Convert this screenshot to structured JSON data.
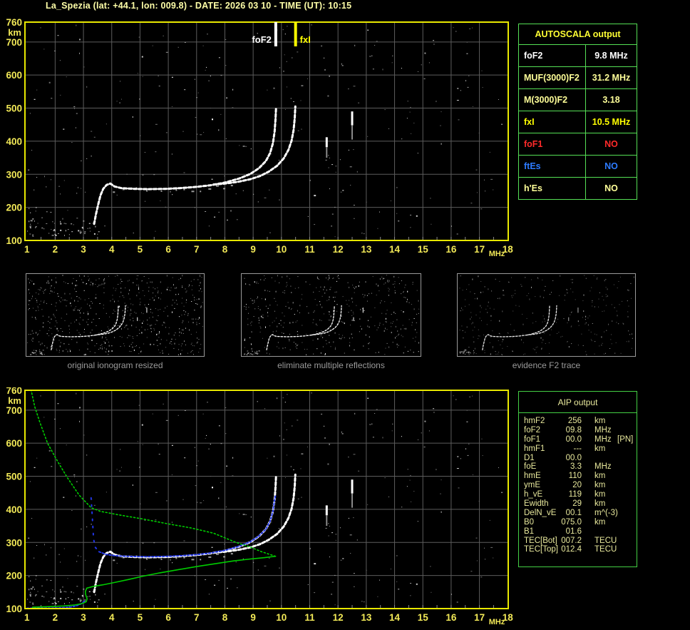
{
  "title": "La_Spezia (lat: +44.1, lon: 009.8) - DATE: 2026 03 10 - TIME (UT): 10:15",
  "colors": {
    "background": "#000000",
    "plot_border": "#e8e800",
    "grid": "#5c5c5c",
    "axis_label": "#f2e957",
    "title_text": "#ffffa8",
    "autoscala_border": "#55e055",
    "aip_border": "#44d044",
    "aip_text": "#e8e89c",
    "echo_trace_white": "#ffffff",
    "restored_trace_blue": "#2236e8",
    "profile_green": "#00cc00",
    "caption_gray": "#9a9a9a"
  },
  "autoscala": {
    "header": "AUTOSCALA output",
    "rows": [
      {
        "label": "foF2",
        "value": "9.8 MHz",
        "color": "#ffffff"
      },
      {
        "label": "MUF(3000)F2",
        "value": "31.2 MHz",
        "color": "#ffff99"
      },
      {
        "label": "M(3000)F2",
        "value": "3.18",
        "color": "#ffff99"
      },
      {
        "label": "fxI",
        "value": "10.5 MHz",
        "color": "#ffff00"
      },
      {
        "label": "foF1",
        "value": "NO",
        "color": "#ff2a2a"
      },
      {
        "label": "ftEs",
        "value": "NO",
        "color": "#2d7bff"
      },
      {
        "label": "h'Es",
        "value": "NO",
        "color": "#ffff99"
      }
    ]
  },
  "aip": {
    "header": "AIP output",
    "rows": [
      {
        "label": "hmF2",
        "value": "256",
        "unit": "km",
        "note": ""
      },
      {
        "label": "foF2",
        "value": "09.8",
        "unit": "MHz",
        "note": ""
      },
      {
        "label": "foF1",
        "value": "00.0",
        "unit": "MHz",
        "note": "[PN]"
      },
      {
        "label": "hmF1",
        "value": "---",
        "unit": "km",
        "note": ""
      },
      {
        "label": "D1",
        "value": "00.0",
        "unit": "",
        "note": ""
      },
      {
        "label": "foE",
        "value": "3.3",
        "unit": "MHz",
        "note": ""
      },
      {
        "label": "hmE",
        "value": "110",
        "unit": "km",
        "note": ""
      },
      {
        "label": "ymE",
        "value": "20",
        "unit": "km",
        "note": ""
      },
      {
        "label": "h_vE",
        "value": "119",
        "unit": "km",
        "note": ""
      },
      {
        "label": "Ewidth",
        "value": "29",
        "unit": "km",
        "note": ""
      },
      {
        "label": "DelN_vE",
        "value": "00.1",
        "unit": "m^(-3)",
        "note": ""
      },
      {
        "label": "B0",
        "value": "075.0",
        "unit": "km",
        "note": ""
      },
      {
        "label": "B1",
        "value": "01.6",
        "unit": "",
        "note": ""
      },
      {
        "label": "TEC[Bot]",
        "value": "007.2",
        "unit": "TECU",
        "note": ""
      },
      {
        "label": "TEC[Top]",
        "value": "012.4",
        "unit": "TECU",
        "note": ""
      }
    ]
  },
  "thumbnails": [
    {
      "caption": "original ionogram resized"
    },
    {
      "caption": "eliminate multiple reflections"
    },
    {
      "caption": "evidence F2 trace"
    }
  ],
  "chart_data": [
    {
      "type": "scatter",
      "name": "ionogram-echo-plot",
      "xlabel": "MHz",
      "ylabel": "km",
      "x_range": [
        1,
        18
      ],
      "y_range": [
        100,
        760
      ],
      "x_ticks": [
        1,
        2,
        3,
        4,
        5,
        6,
        7,
        8,
        9,
        10,
        11,
        12,
        13,
        14,
        15,
        16,
        17,
        18
      ],
      "y_ticks": [
        760,
        700,
        600,
        500,
        400,
        300,
        200,
        100
      ],
      "grid": true,
      "markers": [
        {
          "label": "foF2",
          "freq_mhz": 9.8,
          "color": "#ffffff"
        },
        {
          "label": "fxI",
          "freq_mhz": 10.5,
          "color": "#ffff00"
        }
      ],
      "traces": [
        {
          "name": "F2-ordinary-echo",
          "color": "#ffffff",
          "style": "echo",
          "points": [
            [
              3.38,
              150
            ],
            [
              3.44,
              178
            ],
            [
              3.52,
              208
            ],
            [
              3.6,
              236
            ],
            [
              3.7,
              256
            ],
            [
              3.82,
              268
            ],
            [
              3.95,
              272
            ],
            [
              4.1,
              263
            ],
            [
              4.35,
              258
            ],
            [
              4.8,
              256
            ],
            [
              5.3,
              255
            ],
            [
              5.9,
              256
            ],
            [
              6.4,
              258
            ],
            [
              7.0,
              262
            ],
            [
              7.5,
              267
            ],
            [
              8.0,
              275
            ],
            [
              8.5,
              287
            ],
            [
              8.9,
              301
            ],
            [
              9.2,
              318
            ],
            [
              9.45,
              340
            ],
            [
              9.6,
              364
            ],
            [
              9.7,
              394
            ],
            [
              9.76,
              430
            ],
            [
              9.79,
              466
            ],
            [
              9.81,
              502
            ]
          ]
        },
        {
          "name": "F2-extraordinary-echo",
          "color": "#ffffff",
          "style": "echo",
          "points": [
            [
              7.6,
              269
            ],
            [
              8.0,
              272
            ],
            [
              8.45,
              277
            ],
            [
              8.9,
              285
            ],
            [
              9.25,
              295
            ],
            [
              9.55,
              308
            ],
            [
              9.85,
              326
            ],
            [
              10.08,
              348
            ],
            [
              10.25,
              374
            ],
            [
              10.36,
              402
            ],
            [
              10.43,
              434
            ],
            [
              10.47,
              470
            ],
            [
              10.49,
              505
            ]
          ]
        }
      ],
      "interference_streaks": [
        {
          "freq_mhz": 11.6,
          "white_km": [
            412,
            382
          ],
          "gray_km": [
            382,
            350
          ]
        },
        {
          "freq_mhz": 12.5,
          "white_km": [
            490,
            448
          ],
          "gray_km": [
            448,
            405
          ]
        }
      ]
    },
    {
      "type": "scatter",
      "name": "ionogram-with-inverted-profile",
      "xlabel": "MHz",
      "ylabel": "km",
      "x_range": [
        1,
        18
      ],
      "y_range": [
        100,
        760
      ],
      "x_ticks": [
        1,
        2,
        3,
        4,
        5,
        6,
        7,
        8,
        9,
        10,
        11,
        12,
        13,
        14,
        15,
        16,
        17,
        18
      ],
      "y_ticks": [
        760,
        700,
        600,
        500,
        400,
        300,
        200,
        100
      ],
      "grid": true,
      "includes_echo_traces_from": "ionogram-echo-plot",
      "traces": [
        {
          "name": "restored-trace-E-baseline",
          "color": "#2236e8",
          "style": "restored",
          "points": [
            [
              1.0,
              101
            ],
            [
              1.6,
              101
            ],
            [
              2.1,
              102
            ],
            [
              2.5,
              104
            ],
            [
              2.75,
              108
            ],
            [
              2.95,
              116
            ],
            [
              3.05,
              124
            ]
          ]
        },
        {
          "name": "restored-trace-foE-retardation",
          "color": "#2236e8",
          "style": "sparse",
          "points": [
            [
              3.27,
              435
            ],
            [
              3.3,
              395
            ],
            [
              3.33,
              350
            ],
            [
              3.36,
              310
            ],
            [
              3.42,
              285
            ],
            [
              3.55,
              272
            ]
          ]
        },
        {
          "name": "restored-trace-F2",
          "color": "#2236e8",
          "style": "restored",
          "points": [
            [
              3.55,
              272
            ],
            [
              3.8,
              264
            ],
            [
              4.1,
              260
            ],
            [
              4.5,
              258
            ],
            [
              5.0,
              257
            ],
            [
              5.5,
              257
            ],
            [
              6.0,
              258
            ],
            [
              6.5,
              260
            ],
            [
              7.0,
              263
            ],
            [
              7.5,
              268
            ],
            [
              8.0,
              276
            ],
            [
              8.5,
              288
            ],
            [
              8.9,
              302
            ],
            [
              9.2,
              319
            ],
            [
              9.45,
              340
            ],
            [
              9.6,
              364
            ],
            [
              9.7,
              394
            ],
            [
              9.76,
              430
            ],
            [
              9.79,
              441
            ]
          ]
        },
        {
          "name": "density-profile-bottomside",
          "color": "#00cc00",
          "style": "profile-solid",
          "points": [
            [
              1.2,
              104
            ],
            [
              1.8,
              106
            ],
            [
              2.3,
              108
            ],
            [
              2.7,
              111
            ],
            [
              2.95,
              115
            ],
            [
              3.1,
              121
            ],
            [
              3.13,
              130
            ],
            [
              3.08,
              142
            ],
            [
              3.07,
              152
            ],
            [
              3.12,
              162
            ],
            [
              3.35,
              167
            ],
            [
              3.7,
              172
            ],
            [
              4.1,
              179
            ],
            [
              4.6,
              188
            ],
            [
              5.1,
              198
            ],
            [
              5.7,
              208
            ],
            [
              6.3,
              217
            ],
            [
              7.0,
              227
            ],
            [
              7.6,
              235
            ],
            [
              8.3,
              244
            ],
            [
              8.9,
              250
            ],
            [
              9.4,
              254
            ],
            [
              9.79,
              258
            ]
          ]
        },
        {
          "name": "density-profile-topside",
          "color": "#00cc00",
          "style": "profile-dotted",
          "points": [
            [
              9.79,
              258
            ],
            [
              9.3,
              272
            ],
            [
              8.9,
              286
            ],
            [
              8.4,
              300
            ],
            [
              7.6,
              328
            ],
            [
              6.8,
              344
            ],
            [
              6.0,
              356
            ],
            [
              5.1,
              371
            ],
            [
              4.2,
              384
            ],
            [
              3.6,
              394
            ],
            [
              3.27,
              405
            ],
            [
              2.85,
              443
            ],
            [
              2.44,
              495
            ],
            [
              2.1,
              543
            ],
            [
              1.73,
              600
            ],
            [
              1.45,
              665
            ],
            [
              1.28,
              710
            ],
            [
              1.15,
              760
            ]
          ]
        }
      ]
    }
  ]
}
